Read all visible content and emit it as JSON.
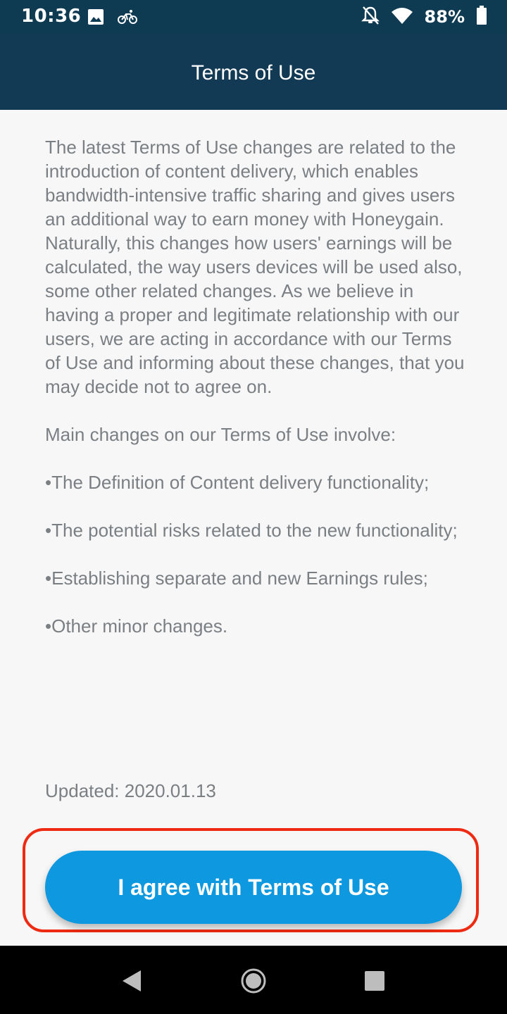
{
  "status_bar": {
    "time": "10:36",
    "battery_percent": "88%",
    "icons": [
      "image-icon",
      "cycling-icon",
      "notifications-off-icon",
      "wifi-icon",
      "battery-icon"
    ]
  },
  "header": {
    "title": "Terms of Use",
    "background": "#123a55"
  },
  "terms": {
    "intro": "The latest Terms of Use changes are related to the introduction of content delivery, which enables bandwidth-intensive traffic sharing and gives users an additional way to earn money with Honeygain. Naturally, this changes how users' earnings will be calculated, the way users devices will be used also, some other related changes. As we believe in having a proper and legitimate relationship with our users, we are acting in accordance with our Terms of Use and informing about these changes, that you may decide not to agree on.",
    "main_changes_heading": "Main changes on our Terms of Use involve:",
    "bullets": [
      "•The Definition of Content delivery functionality;",
      "•The potential risks related to the new functionality;",
      "•Establishing separate and new Earnings rules;",
      "•Other minor changes."
    ],
    "updated": "Updated: 2020.01.13"
  },
  "agree_button": {
    "label": "I agree with Terms of Use",
    "color": "#0d98df"
  },
  "highlight_color": "#ee2a12",
  "nav_bar": {
    "icons": [
      "back-icon",
      "home-icon",
      "recents-icon"
    ]
  }
}
